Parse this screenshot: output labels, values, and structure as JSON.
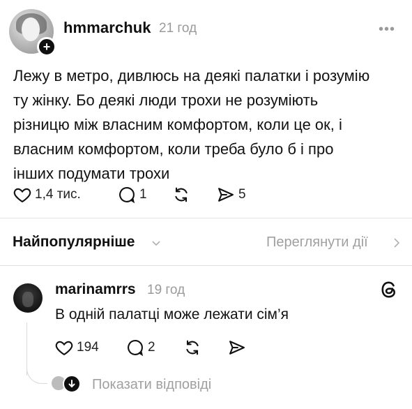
{
  "post": {
    "username": "hmmarchuk",
    "time": "21 год",
    "more_label": "•••",
    "follow_label": "+",
    "text": "Лежу в метро, дивлюсь на деякі палатки і розумію\nту жінку. Бо деякі люди трохи не розуміють\nрізницю між власним комфортом, коли це ок, і\nвласним комфортом, коли треба було б і про\nінших подумати трохи",
    "likes": "1,4 тис.",
    "comments": "1",
    "shares": "5",
    "icons": [
      "heart-icon",
      "comment-icon",
      "repost-icon",
      "share-icon",
      "more-icon",
      "plus-icon"
    ]
  },
  "sort": {
    "label": "Найпопулярніше",
    "view_activity": "Переглянути дії"
  },
  "reply": {
    "username": "marinamrrs",
    "time": "19 год",
    "text": "В одній палатці може лежати сім’я",
    "likes": "194",
    "comments": "2",
    "show_replies": "Показати відповіді"
  },
  "colors": {
    "text": "#101010",
    "muted": "#9a9a9a",
    "divider": "#e2e2e2",
    "background": "#ffffff"
  }
}
